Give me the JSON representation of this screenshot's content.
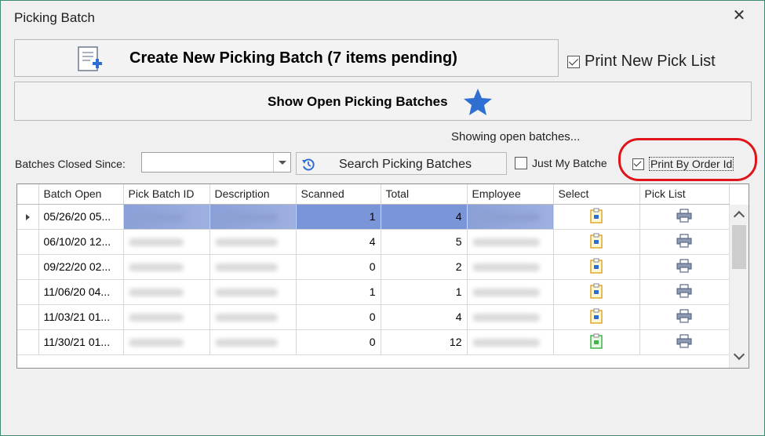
{
  "window": {
    "title": "Picking Batch"
  },
  "buttons": {
    "create": "Create New Picking Batch (7 items pending)",
    "show_open": "Show Open Picking Batches",
    "search": "Search Picking Batches"
  },
  "options": {
    "print_new_pick_list": {
      "label": "Print New Pick List",
      "checked": true
    },
    "just_my_batches": {
      "label": "Just My Batche",
      "checked": false
    },
    "print_by_order_id": {
      "label": "Print By Order Id",
      "checked": true
    }
  },
  "status": "Showing open batches...",
  "filter": {
    "closed_since_label": "Batches Closed Since:",
    "closed_since_value": ""
  },
  "grid": {
    "columns": [
      "Batch Open",
      "Pick Batch ID",
      "Description",
      "Scanned",
      "Total",
      "Employee",
      "Select",
      "Pick List"
    ],
    "rows": [
      {
        "batch_open": "05/26/20 05...",
        "scanned": "1",
        "total": "4",
        "select_icon": "clipboard-yellow-icon",
        "selected": true
      },
      {
        "batch_open": "06/10/20 12...",
        "scanned": "4",
        "total": "5",
        "select_icon": "clipboard-yellow-icon",
        "selected": false
      },
      {
        "batch_open": "09/22/20 02...",
        "scanned": "0",
        "total": "2",
        "select_icon": "clipboard-yellow-icon",
        "selected": false
      },
      {
        "batch_open": "11/06/20 04...",
        "scanned": "1",
        "total": "1",
        "select_icon": "clipboard-yellow-icon",
        "selected": false
      },
      {
        "batch_open": "11/03/21 01...",
        "scanned": "0",
        "total": "4",
        "select_icon": "clipboard-yellow-icon",
        "selected": false
      },
      {
        "batch_open": "11/30/21 01...",
        "scanned": "0",
        "total": "12",
        "select_icon": "clipboard-green-icon",
        "selected": false
      }
    ]
  },
  "colors": {
    "highlight": "#e0141b",
    "selection": "#7a95d8",
    "accent": "#2f6fd1"
  }
}
